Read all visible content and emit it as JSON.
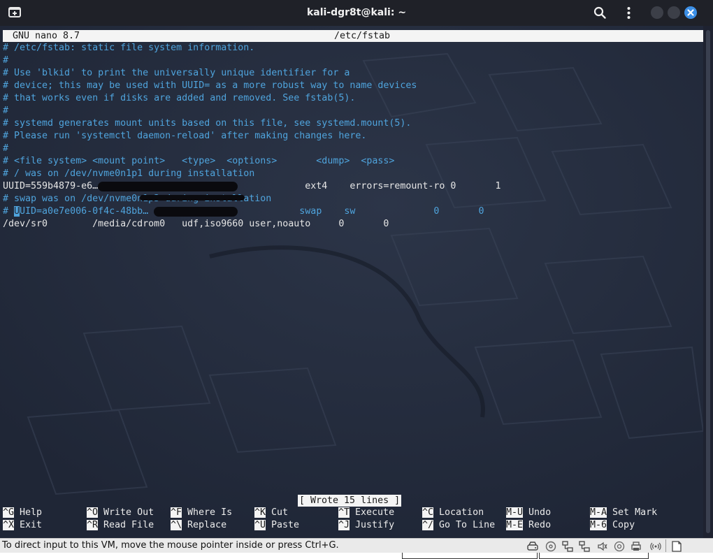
{
  "window": {
    "title": "kali-dgr8t@kali: ~",
    "icons": [
      "new-tab-icon",
      "search-icon",
      "menu-icon",
      "minimize-icon",
      "maximize-icon",
      "close-icon"
    ],
    "close_color": "#3c8fe6"
  },
  "nano": {
    "version": "GNU nano 8.7",
    "filename": "/etc/fstab",
    "lines": [
      "# /etc/fstab: static file system information.",
      "#",
      "# Use 'blkid' to print the universally unique identifier for a",
      "# device; this may be used with UUID= as a more robust way to name devices",
      "# that works even if disks are added and removed. See fstab(5).",
      "#",
      "# systemd generates mount units based on this file, see systemd.mount(5).",
      "# Please run 'systemctl daemon-reload' after making changes here.",
      "#",
      "# <file system> <mount point>   <type>  <options>       <dump>  <pass>",
      "# / was on /dev/nvme0n1p1 during installation",
      "UUID=559b4879-e6…                     /               ext4    errors=remount-ro 0       1",
      "# swap was on /dev/nvme0n1p3 during installation",
      "# UUID=a0e7e006-0f4c-48bb…           none            swap    sw              0       0",
      "/dev/sr0        /media/cdrom0   udf,iso9660 user,noauto     0       0"
    ],
    "line_colors": [
      "comment",
      "comment",
      "comment",
      "comment",
      "comment",
      "comment",
      "comment",
      "comment",
      "comment",
      "comment",
      "comment",
      "plain",
      "comment",
      "comment",
      "plain"
    ],
    "status_message": "[ Wrote 15 lines ]",
    "shortcuts": [
      {
        "key": "^G",
        "label": "Help"
      },
      {
        "key": "^X",
        "label": "Exit"
      },
      {
        "key": "^O",
        "label": "Write Out"
      },
      {
        "key": "^R",
        "label": "Read File"
      },
      {
        "key": "^F",
        "label": "Where Is"
      },
      {
        "key": "^\\",
        "label": "Replace"
      },
      {
        "key": "^K",
        "label": "Cut"
      },
      {
        "key": "^U",
        "label": "Paste"
      },
      {
        "key": "^T",
        "label": "Execute"
      },
      {
        "key": "^J",
        "label": "Justify"
      },
      {
        "key": "^C",
        "label": "Location"
      },
      {
        "key": "^/",
        "label": "Go To Line"
      },
      {
        "key": "M-U",
        "label": "Undo"
      },
      {
        "key": "M-E",
        "label": "Redo"
      },
      {
        "key": "M-A",
        "label": "Set Mark"
      },
      {
        "key": "M-6",
        "label": "Copy"
      }
    ]
  },
  "vm": {
    "message": "To direct input to this VM, move the mouse pointer inside or press Ctrl+G.",
    "icons": [
      "hard-disk-icon",
      "cd-icon",
      "network-icon",
      "network-icon-2",
      "sound-icon",
      "usb-icon",
      "wireless-icon",
      "notes-icon"
    ]
  }
}
